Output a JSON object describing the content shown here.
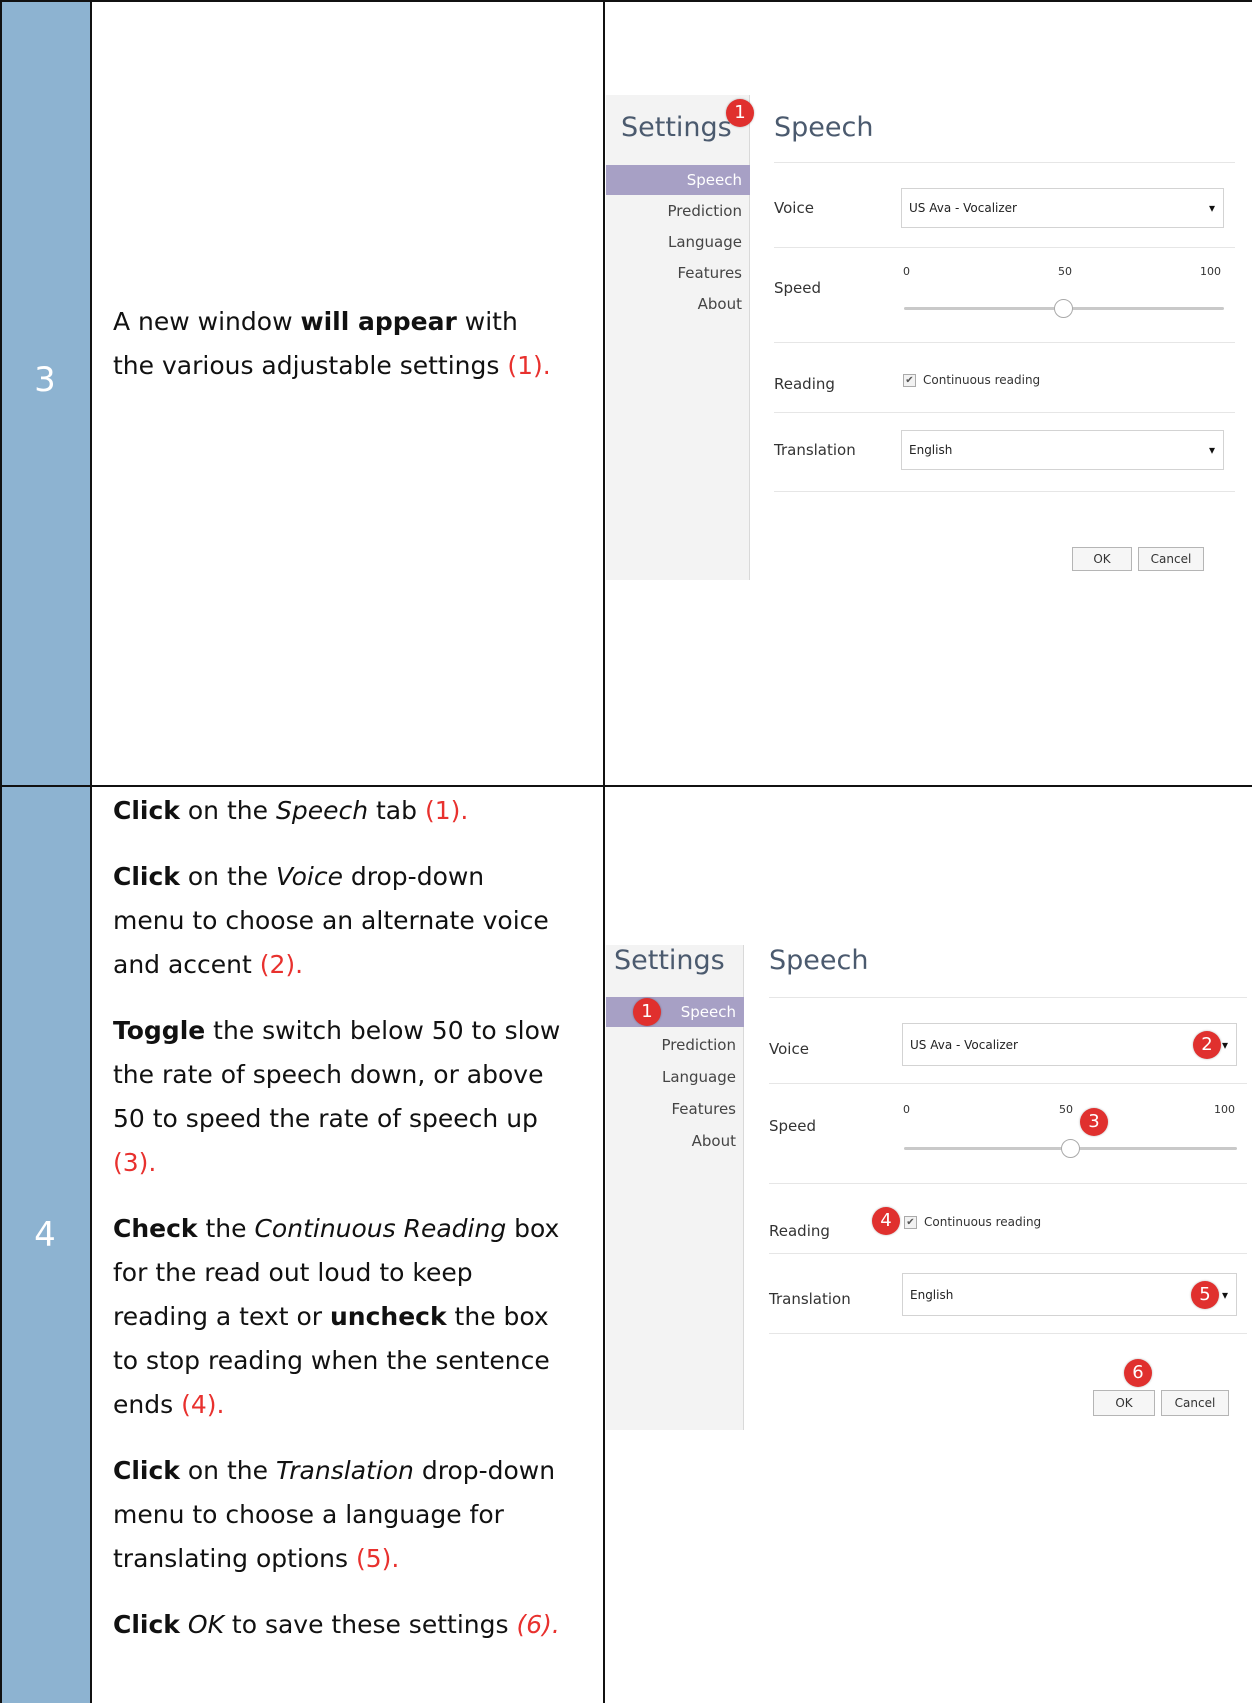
{
  "colors": {
    "step_column": "#8db3d1",
    "accent_red": "#e8312e",
    "nav_selected": "#a7a0c5",
    "badge": "#e0302e"
  },
  "step3": {
    "number": "3",
    "text_parts": [
      "A new window ",
      "will appear",
      " with the various adjustable settings ",
      "(1)."
    ],
    "screenshot": {
      "settings_title": "Settings",
      "badge": "1",
      "section_title": "Speech",
      "nav": [
        "Speech",
        "Prediction",
        "Language",
        "Features",
        "About"
      ],
      "voice_label": "Voice",
      "voice_value": "US Ava - Vocalizer",
      "speed_label": "Speed",
      "speed_ticks": [
        "0",
        "50",
        "100"
      ],
      "speed_value": 50,
      "reading_label": "Reading",
      "continuous_reading": "Continuous reading",
      "translation_label": "Translation",
      "translation_value": "English",
      "ok": "OK",
      "cancel": "Cancel",
      "arrow": "▾",
      "check": "✔"
    }
  },
  "step4": {
    "number": "4",
    "p1": [
      "Click",
      " on the ",
      "Speech",
      " tab ",
      "(1)."
    ],
    "p2": [
      "Click",
      " on the ",
      "Voice",
      " drop-down menu to choose an alternate voice and accent ",
      "(2)."
    ],
    "p3": [
      "Toggle",
      " the switch below 50 to slow the rate of speech down, or above 50 to speed the rate of speech up ",
      "(3)."
    ],
    "p4": [
      "Check",
      " the ",
      "Continuous Reading",
      " box for the read out loud to keep reading a text or ",
      "uncheck",
      " the box to stop reading when the sentence ends ",
      "(4)."
    ],
    "p5": [
      "Click",
      " on the ",
      "Translation",
      " drop-down menu to choose a language for translating options ",
      "(5)."
    ],
    "p6": [
      "Click",
      " ",
      "OK",
      " to save these settings ",
      "(6)."
    ],
    "screenshot": {
      "settings_title": "Settings",
      "section_title": "Speech",
      "nav": [
        "Speech",
        "Prediction",
        "Language",
        "Features",
        "About"
      ],
      "voice_label": "Voice",
      "voice_value": "US Ava - Vocalizer",
      "speed_label": "Speed",
      "speed_ticks": [
        "0",
        "50",
        "100"
      ],
      "speed_value": 50,
      "reading_label": "Reading",
      "continuous_reading": "Continuous reading",
      "translation_label": "Translation",
      "translation_value": "English",
      "ok": "OK",
      "cancel": "Cancel",
      "arrow": "▾",
      "check": "✔",
      "badges": [
        "1",
        "2",
        "3",
        "4",
        "5",
        "6"
      ]
    }
  }
}
